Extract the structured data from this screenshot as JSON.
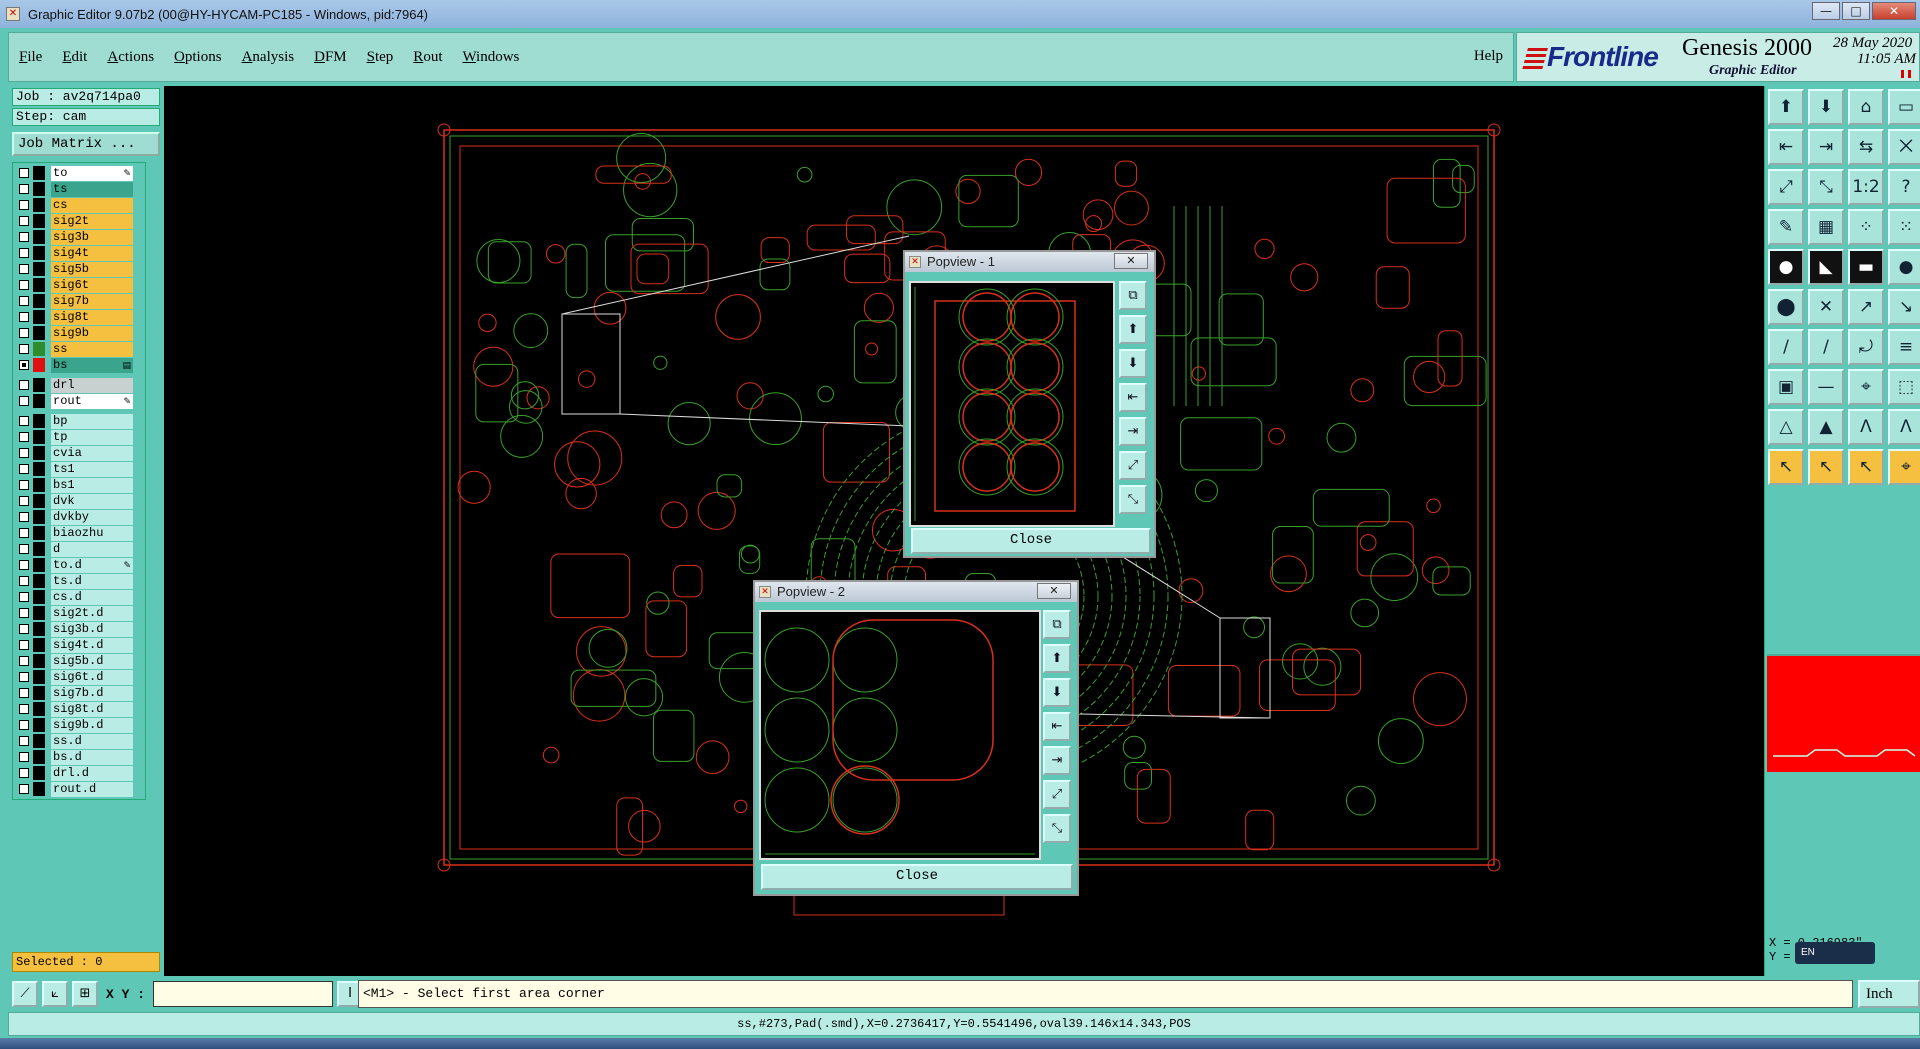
{
  "window": {
    "title": "Graphic Editor 9.07b2 (00@HY-HYCAM-PC185 - Windows, pid:7964)",
    "controls": [
      "—",
      "□",
      "✕"
    ]
  },
  "menu": {
    "items": [
      {
        "ul": "F",
        "rest": "ile"
      },
      {
        "ul": "E",
        "rest": "dit"
      },
      {
        "ul": "A",
        "rest": "ctions"
      },
      {
        "ul": "O",
        "rest": "ptions"
      },
      {
        "ul": "A",
        "rest": "nalysis"
      },
      {
        "ul": "D",
        "rest": "FM"
      },
      {
        "ul": "S",
        "rest": "tep"
      },
      {
        "ul": "R",
        "rest": "out"
      },
      {
        "ul": "W",
        "rest": "indows"
      }
    ],
    "help": "Help"
  },
  "brand": {
    "logo": "Frontline",
    "product": "Genesis 2000",
    "subtitle": "Graphic Editor",
    "date": "28 May 2020",
    "time": "11:05 AM"
  },
  "job": {
    "job_label": "Job : av2q714pa0",
    "step_label": "Step: cam",
    "matrix_button": "Job Matrix ..."
  },
  "layers": {
    "group1": [
      {
        "name": "to",
        "color": "#ffffff",
        "check": false,
        "mark": "✎"
      },
      {
        "name": "ts",
        "color": "#3aa58c",
        "check": false,
        "mark": ""
      },
      {
        "name": "cs",
        "color": "#f5c040",
        "check": false,
        "mark": ""
      },
      {
        "name": "sig2t",
        "color": "#f5c040",
        "check": false,
        "mark": ""
      },
      {
        "name": "sig3b",
        "color": "#f5c040",
        "check": false,
        "mark": ""
      },
      {
        "name": "sig4t",
        "color": "#f5c040",
        "check": false,
        "mark": ""
      },
      {
        "name": "sig5b",
        "color": "#f5c040",
        "check": false,
        "mark": ""
      },
      {
        "name": "sig6t",
        "color": "#f5c040",
        "check": false,
        "mark": ""
      },
      {
        "name": "sig7b",
        "color": "#f5c040",
        "check": false,
        "mark": ""
      },
      {
        "name": "sig8t",
        "color": "#f5c040",
        "check": false,
        "mark": ""
      },
      {
        "name": "sig9b",
        "color": "#f5c040",
        "check": false,
        "mark": ""
      },
      {
        "name": "ss",
        "color": "#f5c040",
        "check": false,
        "mark": "",
        "swatch": "#2e8b2e"
      },
      {
        "name": "bs",
        "color": "#3aa58c",
        "check": true,
        "mark": "▤",
        "swatch": "#e01010"
      }
    ],
    "group2": [
      {
        "name": "drl",
        "color": "#c8d0d0",
        "check": false,
        "mark": ""
      },
      {
        "name": "rout",
        "color": "#ffffff",
        "check": false,
        "mark": "✎"
      }
    ],
    "group3": [
      {
        "name": "bp",
        "color": "#b9ece4",
        "check": false,
        "mark": ""
      },
      {
        "name": "tp",
        "color": "#b9ece4",
        "check": false,
        "mark": ""
      },
      {
        "name": "cvia",
        "color": "#b9ece4",
        "check": false,
        "mark": ""
      },
      {
        "name": "ts1",
        "color": "#b9ece4",
        "check": false,
        "mark": ""
      },
      {
        "name": "bs1",
        "color": "#b9ece4",
        "check": false,
        "mark": ""
      },
      {
        "name": "dvk",
        "color": "#b9ece4",
        "check": false,
        "mark": ""
      },
      {
        "name": "dvkby",
        "color": "#b9ece4",
        "check": false,
        "mark": ""
      },
      {
        "name": "biaozhu",
        "color": "#b9ece4",
        "check": false,
        "mark": ""
      },
      {
        "name": "d",
        "color": "#b9ece4",
        "check": false,
        "mark": ""
      },
      {
        "name": "to.d",
        "color": "#b9ece4",
        "check": false,
        "mark": "✎"
      },
      {
        "name": "ts.d",
        "color": "#b9ece4",
        "check": false,
        "mark": ""
      },
      {
        "name": "cs.d",
        "color": "#b9ece4",
        "check": false,
        "mark": ""
      },
      {
        "name": "sig2t.d",
        "color": "#b9ece4",
        "check": false,
        "mark": ""
      },
      {
        "name": "sig3b.d",
        "color": "#b9ece4",
        "check": false,
        "mark": ""
      },
      {
        "name": "sig4t.d",
        "color": "#b9ece4",
        "check": false,
        "mark": ""
      },
      {
        "name": "sig5b.d",
        "color": "#b9ece4",
        "check": false,
        "mark": ""
      },
      {
        "name": "sig6t.d",
        "color": "#b9ece4",
        "check": false,
        "mark": ""
      },
      {
        "name": "sig7b.d",
        "color": "#b9ece4",
        "check": false,
        "mark": ""
      },
      {
        "name": "sig8t.d",
        "color": "#b9ece4",
        "check": false,
        "mark": ""
      },
      {
        "name": "sig9b.d",
        "color": "#b9ece4",
        "check": false,
        "mark": ""
      },
      {
        "name": "ss.d",
        "color": "#b9ece4",
        "check": false,
        "mark": ""
      },
      {
        "name": "bs.d",
        "color": "#b9ece4",
        "check": false,
        "mark": ""
      },
      {
        "name": "drl.d",
        "color": "#b9ece4",
        "check": false,
        "mark": ""
      },
      {
        "name": "rout.d",
        "color": "#b9ece4",
        "check": false,
        "mark": ""
      }
    ]
  },
  "selected": "Selected : 0",
  "popview1": {
    "title": "Popview - 1",
    "close": "Close",
    "close_x": "✕"
  },
  "popview2": {
    "title": "Popview - 2",
    "close": "Close",
    "close_x": "✕"
  },
  "popview_tools": [
    "⧉",
    "⬆",
    "⬇",
    "⇤",
    "⇥",
    "⤢",
    "⤡"
  ],
  "right_tools": [
    {
      "icon": "⬆",
      "name": "move-up-icon"
    },
    {
      "icon": "⬇",
      "name": "move-down-icon"
    },
    {
      "icon": "⌂",
      "name": "home-icon"
    },
    {
      "icon": "▭",
      "name": "window-icon"
    },
    {
      "icon": "⇤",
      "name": "pan-left-icon"
    },
    {
      "icon": "⇥",
      "name": "pan-right-icon"
    },
    {
      "icon": "⇆",
      "name": "swap-icon"
    },
    {
      "icon": "⨉",
      "name": "cross-icon"
    },
    {
      "icon": "⤢",
      "name": "zoom-fit-icon"
    },
    {
      "icon": "⤡",
      "name": "zoom-in-icon"
    },
    {
      "icon": "1:2",
      "name": "scale-icon"
    },
    {
      "icon": "?",
      "name": "help-icon"
    },
    {
      "icon": "✎",
      "name": "pen-icon"
    },
    {
      "icon": "▦",
      "name": "grid-icon"
    },
    {
      "icon": "⁘",
      "name": "snap-icon"
    },
    {
      "icon": "⁙",
      "name": "snap-red-icon"
    },
    {
      "icon": "●",
      "name": "pad-icon",
      "style": "dark"
    },
    {
      "icon": "◣",
      "name": "surface-icon",
      "style": "dark"
    },
    {
      "icon": "▬",
      "name": "line-icon",
      "style": "dark"
    },
    {
      "icon": "●",
      "name": "dot-icon"
    },
    {
      "icon": "⬤",
      "name": "node-icon"
    },
    {
      "icon": "✕",
      "name": "delete-icon"
    },
    {
      "icon": "↗",
      "name": "arrow-icon"
    },
    {
      "icon": "↘",
      "name": "arrow-red-icon"
    },
    {
      "icon": "∕",
      "name": "slash-icon"
    },
    {
      "icon": "∕",
      "name": "slash-blue-icon"
    },
    {
      "icon": "⤾",
      "name": "arc-icon"
    },
    {
      "icon": "≡",
      "name": "lines-icon"
    },
    {
      "icon": "▣",
      "name": "pad-edit-icon"
    },
    {
      "icon": "—",
      "name": "dash-icon"
    },
    {
      "icon": "⌖",
      "name": "target-icon"
    },
    {
      "icon": "⬚",
      "name": "shape-icon"
    },
    {
      "icon": "△",
      "name": "triangle-icon"
    },
    {
      "icon": "▲",
      "name": "triangle-red-icon"
    },
    {
      "icon": "Ʌ",
      "name": "arch-icon"
    },
    {
      "icon": "Ʌ",
      "name": "arch-blue-icon"
    },
    {
      "icon": "↖",
      "name": "pointer-icon",
      "style": "hl"
    },
    {
      "icon": "↖",
      "name": "pointer2-icon",
      "style": "hl"
    },
    {
      "icon": "↖",
      "name": "pointer3-icon",
      "style": "hl"
    },
    {
      "icon": "⌖",
      "name": "measure-icon",
      "style": "hl"
    }
  ],
  "coords": {
    "x": "X = 0.216983\"",
    "y": "Y ="
  },
  "ime": "EN",
  "command": {
    "xy_label": "X Y :",
    "xy_value": "",
    "prompt": "<M1> - Select first area corner",
    "units": "Inch"
  },
  "status": "ss,#273,Pad(.smd),X=0.2736417,Y=0.5541496,oval39.146x14.343,POS"
}
